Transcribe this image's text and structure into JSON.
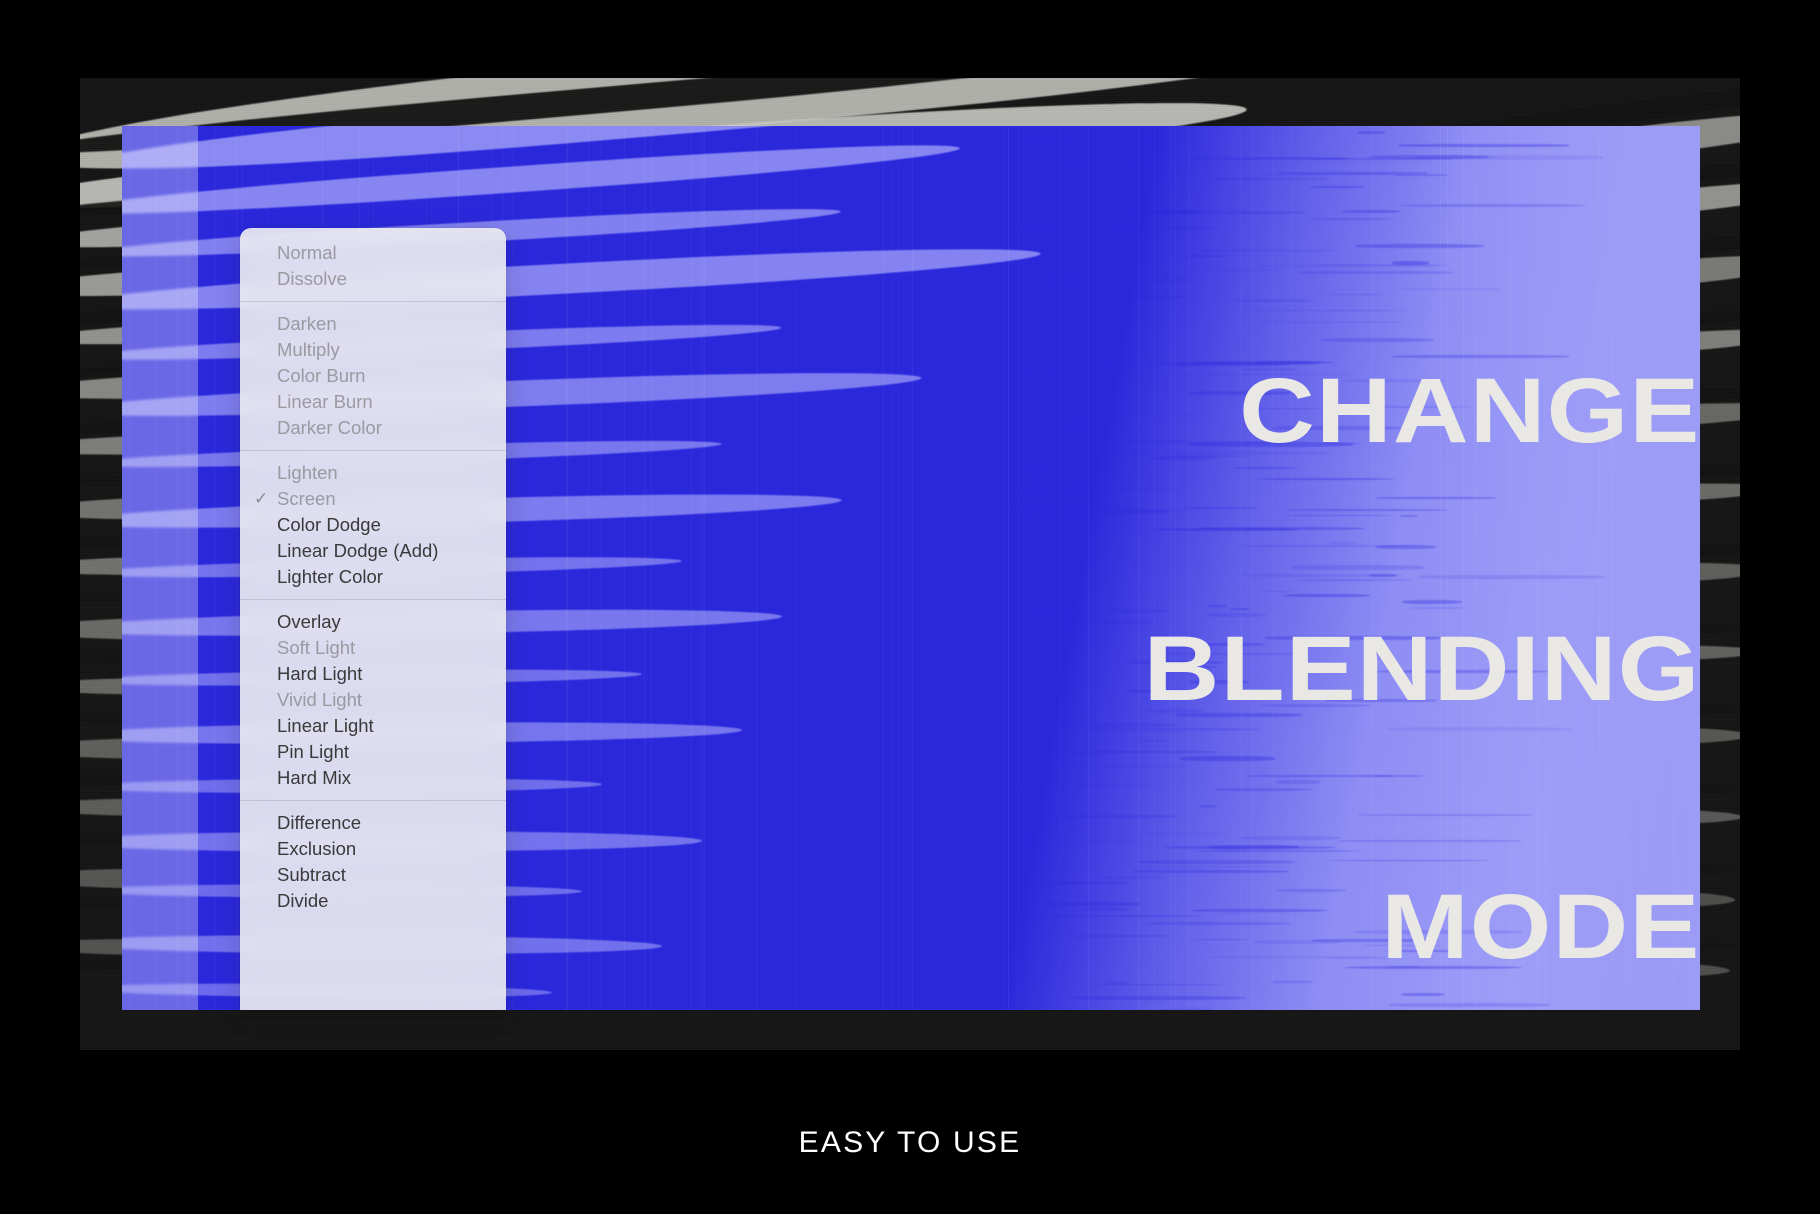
{
  "poster": {
    "headline_lines": [
      "CHANGE",
      "BLENDING",
      "MODE"
    ],
    "caption": "EASY TO USE",
    "colors": {
      "blue": "#2B28DC",
      "periwinkle": "#9A9AF7",
      "headline_text": "#E9E8E4",
      "backing": "#151515",
      "outer": "#000000",
      "menu_bg": "#F1F1F1"
    }
  },
  "menu": {
    "name": "blending-mode-menu",
    "selected": "Screen",
    "check_glyph": "✓",
    "groups": [
      {
        "items": [
          {
            "label": "Normal",
            "dim": true,
            "checked": false
          },
          {
            "label": "Dissolve",
            "dim": true,
            "checked": false
          }
        ]
      },
      {
        "items": [
          {
            "label": "Darken",
            "dim": true,
            "checked": false
          },
          {
            "label": "Multiply",
            "dim": true,
            "checked": false
          },
          {
            "label": "Color Burn",
            "dim": true,
            "checked": false
          },
          {
            "label": "Linear Burn",
            "dim": true,
            "checked": false
          },
          {
            "label": "Darker Color",
            "dim": true,
            "checked": false
          }
        ]
      },
      {
        "items": [
          {
            "label": "Lighten",
            "dim": true,
            "checked": false
          },
          {
            "label": "Screen",
            "dim": true,
            "checked": true
          },
          {
            "label": "Color Dodge",
            "dim": false,
            "checked": false
          },
          {
            "label": "Linear Dodge (Add)",
            "dim": false,
            "checked": false
          },
          {
            "label": "Lighter Color",
            "dim": false,
            "checked": false
          }
        ]
      },
      {
        "items": [
          {
            "label": "Overlay",
            "dim": false,
            "checked": false
          },
          {
            "label": "Soft Light",
            "dim": true,
            "checked": false
          },
          {
            "label": "Hard Light",
            "dim": false,
            "checked": false
          },
          {
            "label": "Vivid Light",
            "dim": true,
            "checked": false
          },
          {
            "label": "Linear Light",
            "dim": false,
            "checked": false
          },
          {
            "label": "Pin Light",
            "dim": false,
            "checked": false
          },
          {
            "label": "Hard Mix",
            "dim": false,
            "checked": false
          }
        ]
      },
      {
        "items": [
          {
            "label": "Difference",
            "dim": false,
            "checked": false
          },
          {
            "label": "Exclusion",
            "dim": false,
            "checked": false
          },
          {
            "label": "Subtract",
            "dim": false,
            "checked": false
          },
          {
            "label": "Divide",
            "dim": false,
            "checked": false
          }
        ]
      }
    ]
  }
}
